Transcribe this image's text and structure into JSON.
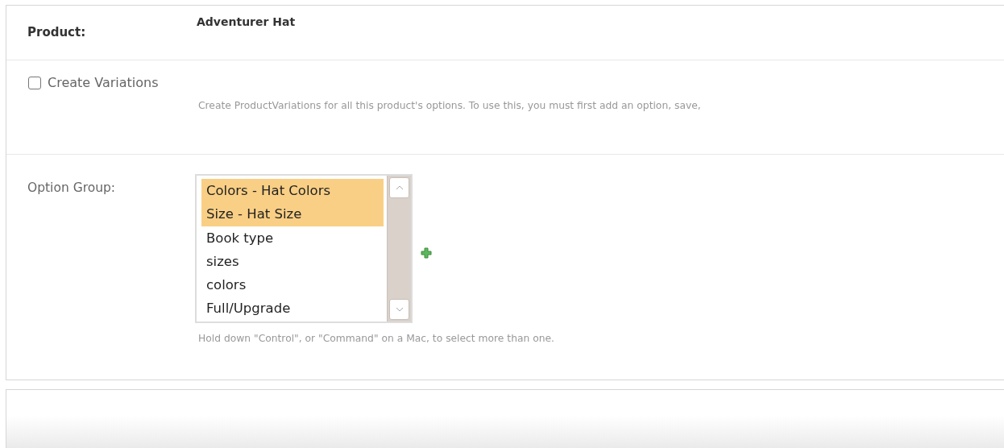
{
  "product": {
    "label": "Product:",
    "value": "Adventurer Hat"
  },
  "create_variations": {
    "label": "Create Variations",
    "checked": false,
    "help": "Create ProductVariations for all this product's options. To use this, you must first add an option, save,"
  },
  "option_group": {
    "label": "Option Group:",
    "options": [
      {
        "label": "Colors - Hat Colors",
        "selected": true
      },
      {
        "label": "Size - Hat Size",
        "selected": true
      },
      {
        "label": "Book type",
        "selected": false
      },
      {
        "label": "sizes",
        "selected": false
      },
      {
        "label": "colors",
        "selected": false
      },
      {
        "label": "Full/Upgrade",
        "selected": false
      }
    ],
    "help": "Hold down \"Control\", or \"Command\" on a Mac, to select more than one."
  }
}
